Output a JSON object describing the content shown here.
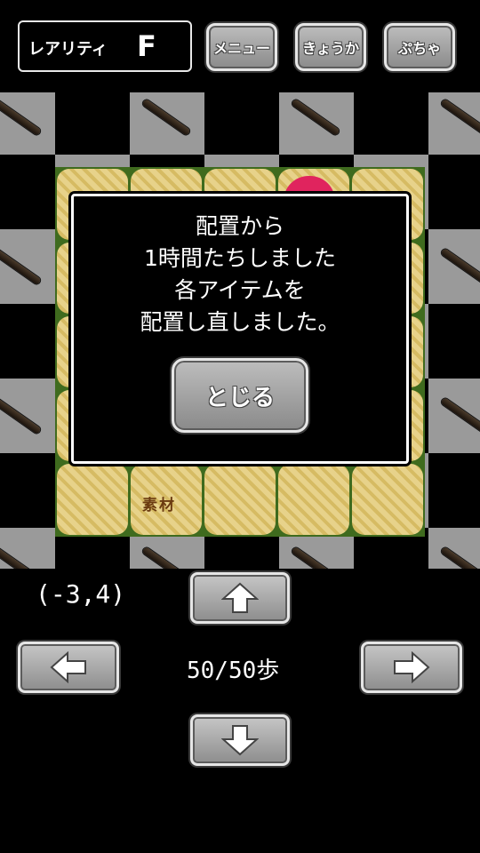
{
  "top_bar": {
    "rarity_label": "レアリティ",
    "rarity_grade": "F",
    "menu_label": "メニュー",
    "kyouka_label": "きょうか",
    "gacha_label": "ぷちゃ"
  },
  "board": {
    "material_label": "素材"
  },
  "dialog": {
    "lines": [
      "配置から",
      "1時間たちしました",
      "各アイテムを",
      "配置し直しました。"
    ],
    "close_label": "とじる"
  },
  "controls": {
    "coordinates": "(-3,4)",
    "steps": "50/50歩"
  },
  "colors": {
    "background": "#000000",
    "checker_light": "#9a9a9a",
    "tile_sand": "#e3cd82",
    "grass": "#3f6b1e",
    "button_gray": "#a9a9a9",
    "monster": "#e0245e"
  }
}
